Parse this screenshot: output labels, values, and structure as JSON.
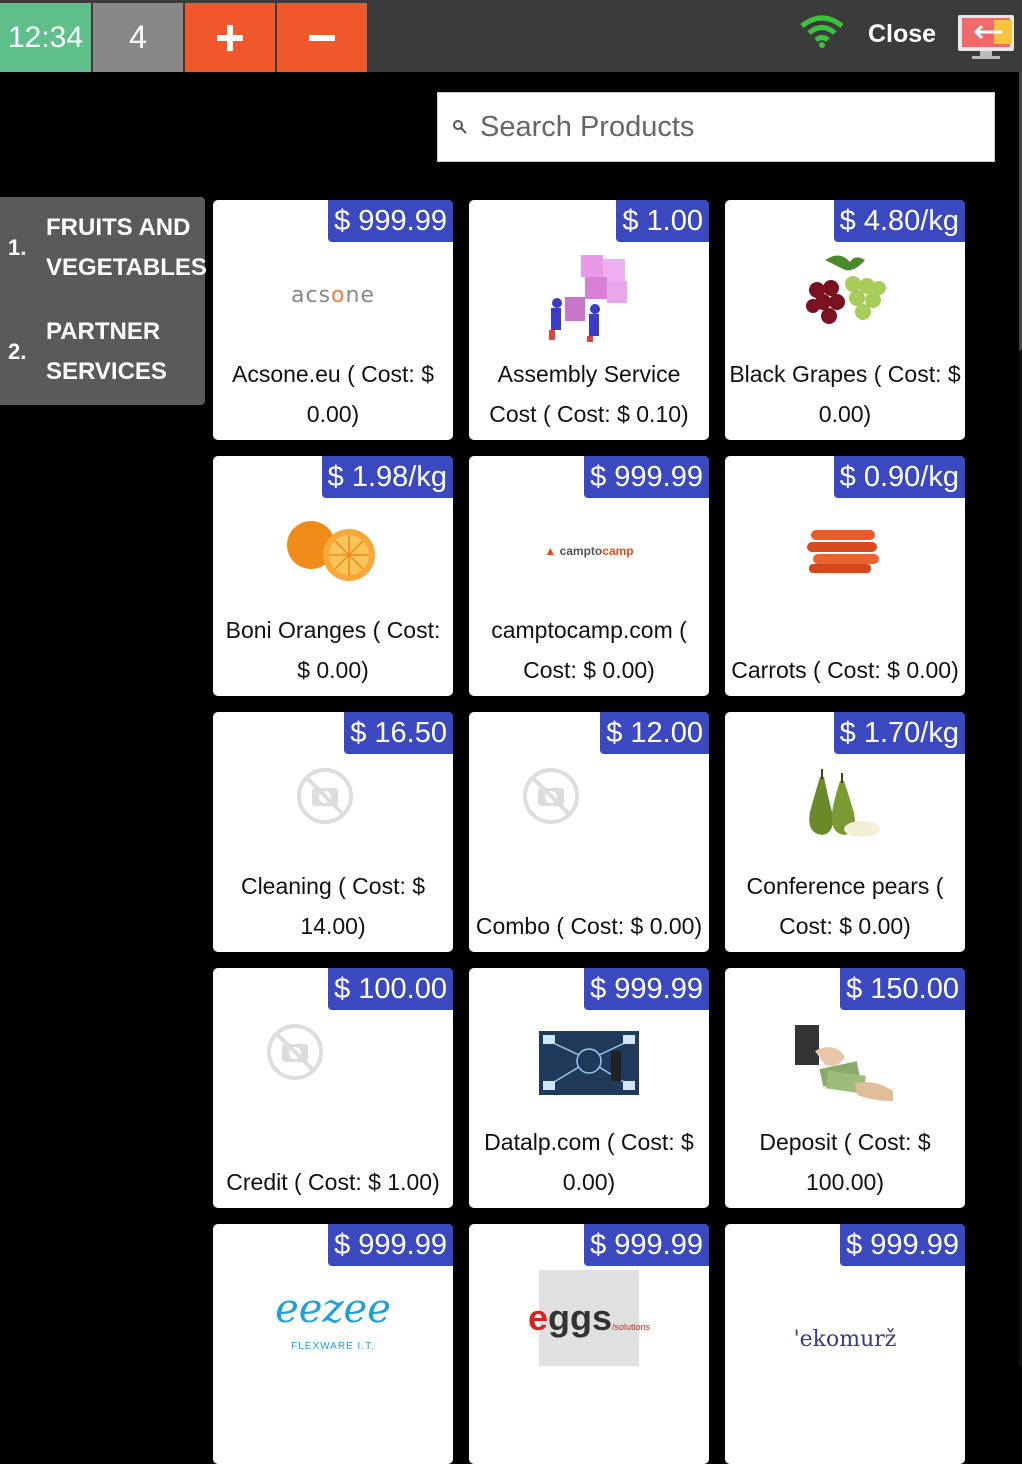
{
  "topbar": {
    "clock": "12:34",
    "count": "4",
    "plus_label": "+",
    "minus_label": "−",
    "close_label": "Close"
  },
  "search": {
    "placeholder": "Search Products"
  },
  "categories": [
    {
      "num": "1.",
      "name": "FRUITS AND VEGETABLES"
    },
    {
      "num": "2.",
      "name": "PARTNER SERVICES"
    }
  ],
  "products": [
    {
      "price": "$ 999.99",
      "name": "Acsone.eu ( Cost: $ 0.00)",
      "image": "acsone-logo"
    },
    {
      "price": "$ 1.00",
      "name": "Assembly Service Cost ( Cost: $ 0.10)",
      "image": "puzzle-people"
    },
    {
      "price": "$ 4.80/kg",
      "name": "Black Grapes ( Cost: $ 0.00)",
      "image": "grapes"
    },
    {
      "price": "$ 1.98/kg",
      "name": "Boni Oranges ( Cost: $ 0.00)",
      "image": "oranges"
    },
    {
      "price": "$ 999.99",
      "name": "camptocamp.com ( Cost: $ 0.00)",
      "image": "camptocamp-logo"
    },
    {
      "price": "$ 0.90/kg",
      "name": "Carrots ( Cost: $ 0.00)",
      "image": "carrots"
    },
    {
      "price": "$ 16.50",
      "name": "Cleaning ( Cost: $ 14.00)",
      "image": "no-image"
    },
    {
      "price": "$ 12.00",
      "name": "Combo ( Cost: $ 0.00)",
      "image": "no-image"
    },
    {
      "price": "$ 1.70/kg",
      "name": "Conference pears ( Cost: $ 0.00)",
      "image": "pears"
    },
    {
      "price": "$ 100.00",
      "name": "Credit ( Cost: $ 1.00)",
      "image": "no-image"
    },
    {
      "price": "$ 999.99",
      "name": "Datalp.com ( Cost: $ 0.00)",
      "image": "datalp"
    },
    {
      "price": "$ 150.00",
      "name": "Deposit ( Cost: $ 100.00)",
      "image": "money-hands"
    },
    {
      "price": "$ 999.99",
      "name": "",
      "image": "eezee-logo",
      "image_text": "FLEXWARE I.T."
    },
    {
      "price": "$ 999.99",
      "name": "",
      "image": "eggs-logo"
    },
    {
      "price": "$ 999.99",
      "name": "",
      "image": "ekomurz-logo"
    }
  ],
  "colors": {
    "clock_bg": "#5fbf8a",
    "plus_minus_bg": "#f0572a",
    "price_badge": "#3b49c1",
    "wifi": "#3cc23c"
  }
}
